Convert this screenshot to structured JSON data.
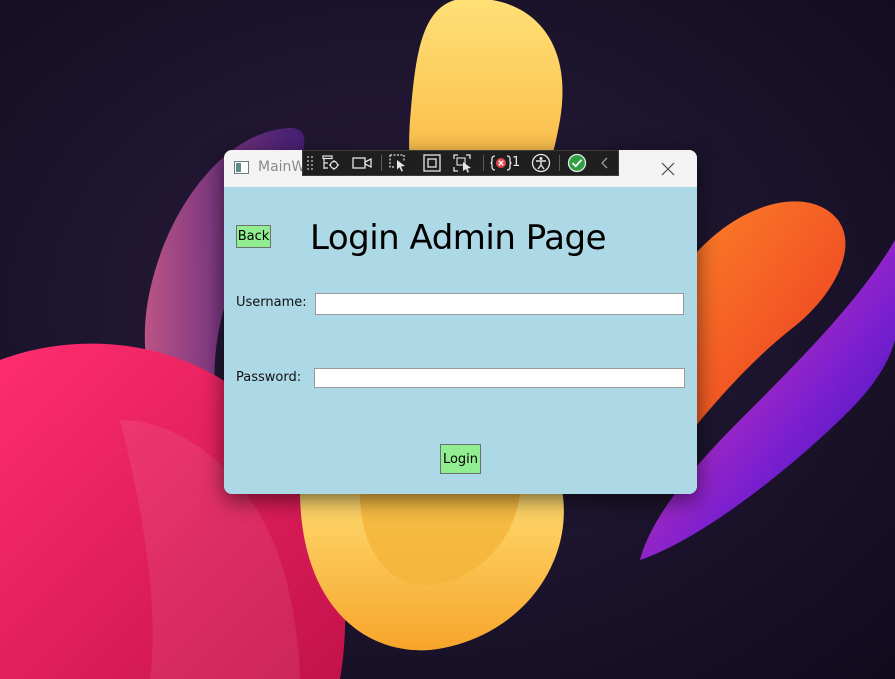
{
  "window": {
    "title": "MainW",
    "close_icon": "close-icon"
  },
  "debug_toolbar": {
    "icons": [
      "grip-icon",
      "select-element-icon",
      "live-preview-icon",
      "select-element-in-app-icon",
      "display-layout-adorners-icon",
      "track-focus-icon",
      "binding-failures-icon",
      "accessibility-icon",
      "hot-reload-status-icon",
      "collapse-chevron-icon"
    ],
    "binding_failures_count": "1"
  },
  "page": {
    "title": "Login Admin Page",
    "back_label": "Back",
    "username_label": "Username:",
    "username_value": "",
    "password_label": "Password:",
    "password_value": "",
    "login_label": "Login"
  },
  "colors": {
    "client_background": "#add8e6",
    "button_background": "#90ee90",
    "titlebar_background": "#f3f3f3",
    "debug_toolbar_background": "#1f1f1f",
    "hot_reload_ok": "#2ea043",
    "binding_failure_red": "#e5484d"
  }
}
